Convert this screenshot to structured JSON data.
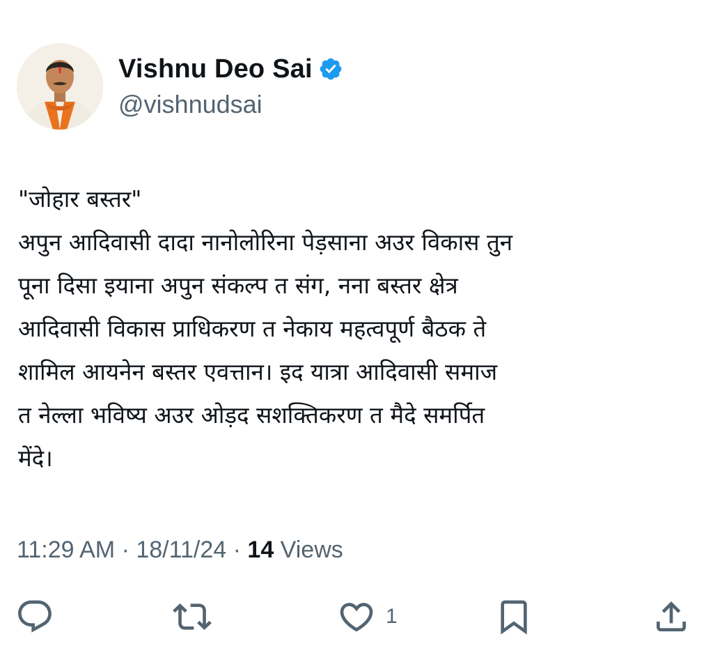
{
  "author": {
    "display_name": "Vishnu Deo Sai",
    "handle": "@vishnudsai",
    "verified": true,
    "verified_icon": "verified-badge-icon",
    "accent_color": "#1d9bf0"
  },
  "tweet": {
    "lines": [
      "\"जोहार बस्तर\"",
      "अपुन आदिवासी दादा नानोलोरिना पेड़साना अउर विकास तुन",
      "पूना दिसा इयाना अपुन संकल्प त संग, नना बस्तर क्षेत्र",
      "आदिवासी विकास प्राधिकरण त नेकाय महत्वपूर्ण बैठक ते",
      "शामिल आयनेन बस्तर एवत्तान। इद यात्रा आदिवासी समाज",
      "त नेल्ला भविष्य अउर ओड़द सशक्तिकरण त मैदे समर्पित",
      "मेंदे।"
    ]
  },
  "meta": {
    "time": "11:29 AM",
    "separator": " · ",
    "date": "18/11/24",
    "views_count": "14",
    "views_label": " Views"
  },
  "actions": {
    "reply": {
      "icon": "reply-icon",
      "count": ""
    },
    "repost": {
      "icon": "repost-icon",
      "count": ""
    },
    "like": {
      "icon": "heart-icon",
      "count": "1"
    },
    "bookmark": {
      "icon": "bookmark-icon",
      "count": ""
    },
    "share": {
      "icon": "share-icon",
      "count": ""
    }
  }
}
